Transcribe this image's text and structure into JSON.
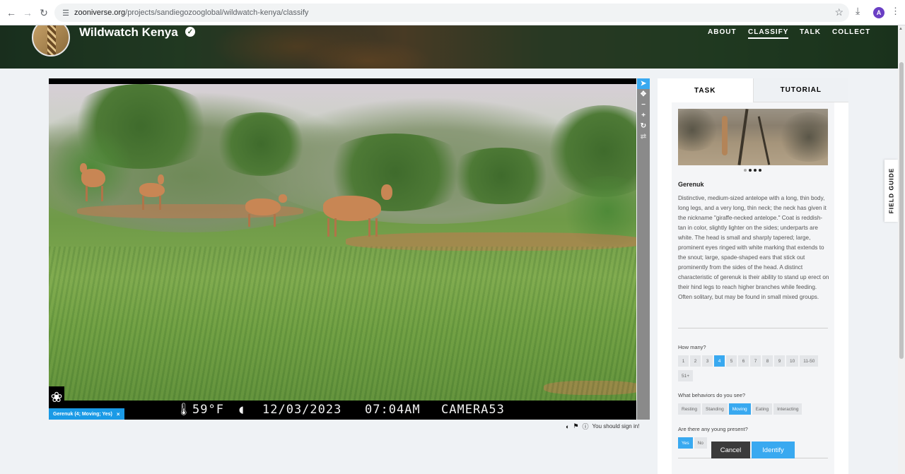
{
  "browser": {
    "url_domain": "zooniverse.org",
    "url_path": "/projects/sandiegozooglobal/wildwatch-kenya/classify",
    "profile_initial": "A"
  },
  "project": {
    "title": "Wildwatch Kenya",
    "nav": {
      "about": "ABOUT",
      "classify": "CLASSIFY",
      "talk": "TALK",
      "collect": "COLLECT"
    }
  },
  "viewer": {
    "hud": {
      "temperature": "59°F",
      "date": "12/03/2023",
      "time": "07:04AM",
      "camera": "CAMERA53"
    },
    "annotation_tag": "Gerenuk (4; Moving; Yes)",
    "annotation_remove": "×",
    "sign_in_prompt": "You should sign in!"
  },
  "task_panel": {
    "tabs": [
      "TASK",
      "TUTORIAL"
    ],
    "species_name": "Gerenuk",
    "species_description": "Distinctive, medium-sized antelope with a long, thin body, long legs, and a very long, thin neck; the neck has given it the nickname \"giraffe-necked antelope.\" Coat is reddish-tan in color, slightly lighter on the sides; underparts are white. The head is small and sharply tapered; large, prominent eyes ringed with white marking that extends to the snout; large, spade-shaped ears that stick out prominently from the sides of the head. A distinct characteristic of gerenuk is their ability to stand up erect on their hind legs to reach higher branches while feeding. Often solitary, but may be found in small mixed groups.",
    "questions": [
      {
        "label": "How many?",
        "options": [
          "1",
          "2",
          "3",
          "4",
          "5",
          "6",
          "7",
          "8",
          "9",
          "10",
          "11-50",
          "51+"
        ],
        "selected": "4"
      },
      {
        "label": "What behaviors do you see?",
        "options": [
          "Resting",
          "Standing",
          "Moving",
          "Eating",
          "Interacting"
        ],
        "selected": "Moving"
      },
      {
        "label": "Are there any young present?",
        "options": [
          "Yes",
          "No"
        ],
        "selected": "Yes"
      }
    ],
    "buttons": {
      "cancel": "Cancel",
      "identify": "Identify"
    },
    "example_images_total": 4,
    "example_images_current": 1
  },
  "field_guide_label": "FIELD GUIDE",
  "colors": {
    "accent": "#39a9f0",
    "annotation_tag": "#1a9ae6",
    "dark_button": "#3b3b3b"
  }
}
